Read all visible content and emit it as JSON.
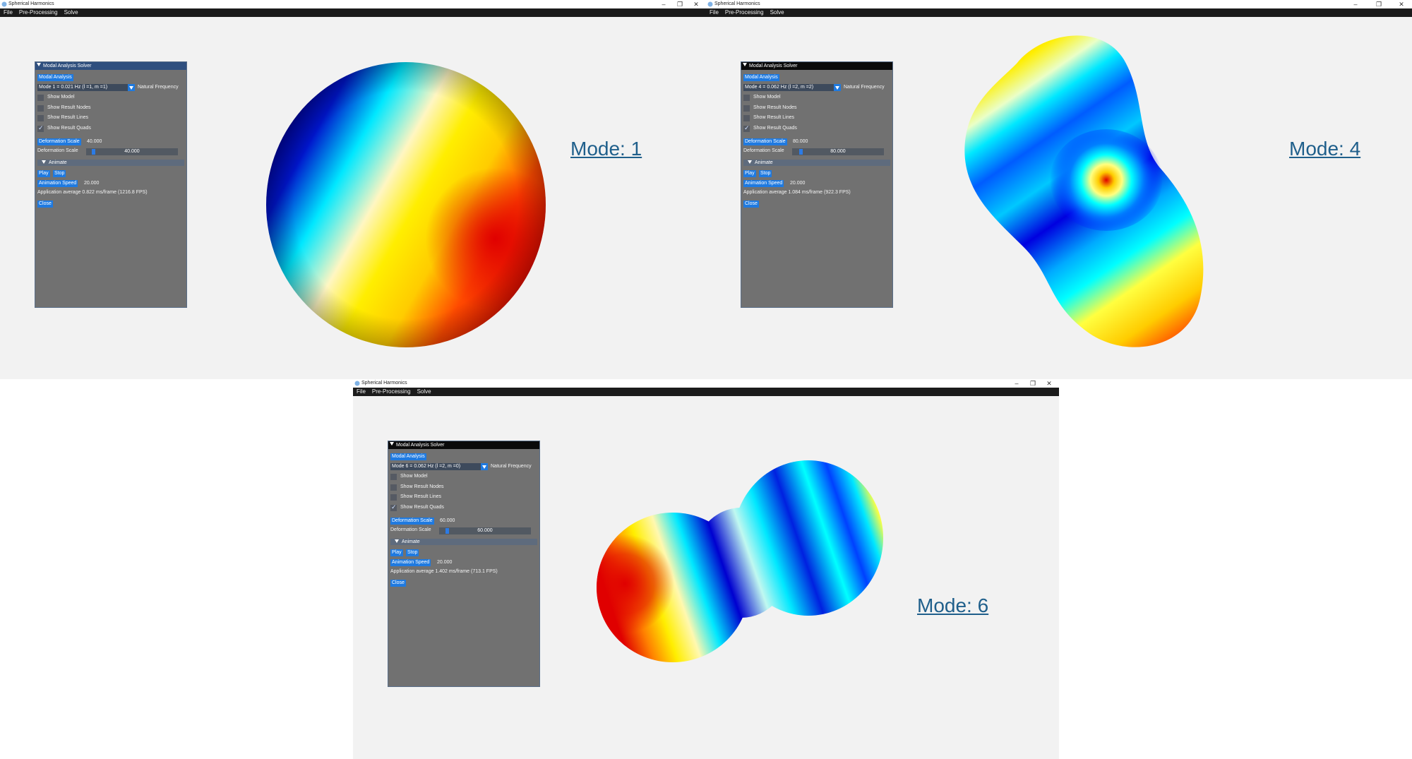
{
  "windows": [
    {
      "title": "Spherical Harmonics",
      "menu": [
        "File",
        "Pre-Processing",
        "Solve"
      ],
      "panel": {
        "title": "Modal Analysis Solver",
        "modal_btn": "Modal Analysis",
        "mode_select": "Mode 1 = 0.021 Hz (l =1, m =1)",
        "freq_label": "Natural Frequency",
        "checks": [
          "Show Model",
          "Show Result Nodes",
          "Show Result Lines",
          "Show Result Quads"
        ],
        "checked": [
          false,
          false,
          false,
          true
        ],
        "def_btn": "Deformation Scale",
        "def_val": "40.000",
        "def_label": "Deformation Scale",
        "def_slider": "40.000",
        "def_fraction": 0.06,
        "animate": "Animate",
        "play": "Play",
        "stop": "Stop",
        "speed_btn": "Animation Speed",
        "speed_val": "20.000",
        "app_avg": "Application average 0.822 ms/frame (1216.8 FPS)",
        "close": "Close"
      },
      "mode_label": "Mode: 1"
    },
    {
      "title": "Spherical Harmonics",
      "menu": [
        "File",
        "Pre-Processing",
        "Solve"
      ],
      "panel": {
        "title": "Modal Analysis Solver",
        "modal_btn": "Modal Analysis",
        "mode_select": "Mode 4 = 0.062 Hz (l =2, m =2)",
        "freq_label": "Natural Frequency",
        "checks": [
          "Show Model",
          "Show Result Nodes",
          "Show Result Lines",
          "Show Result Quads"
        ],
        "checked": [
          false,
          false,
          false,
          true
        ],
        "def_btn": "Deformation Scale",
        "def_val": "80.000",
        "def_label": "Deformation Scale",
        "def_slider": "80.000",
        "def_fraction": 0.08,
        "animate": "Animate",
        "play": "Play",
        "stop": "Stop",
        "speed_btn": "Animation Speed",
        "speed_val": "20.000",
        "app_avg": "Application average 1.084 ms/frame (922.3 FPS)",
        "close": "Close"
      },
      "mode_label": "Mode: 4"
    },
    {
      "title": "Spherical Harmonics",
      "menu": [
        "File",
        "Pre-Processing",
        "Solve"
      ],
      "panel": {
        "title": "Modal Analysis Solver",
        "modal_btn": "Modal Analysis",
        "mode_select": "Mode 6 = 0.062 Hz (l =2, m =0)",
        "freq_label": "Natural Frequency",
        "checks": [
          "Show Model",
          "Show Result Nodes",
          "Show Result Lines",
          "Show Result Quads"
        ],
        "checked": [
          false,
          false,
          false,
          true
        ],
        "def_btn": "Deformation Scale",
        "def_val": "60.000",
        "def_label": "Deformation Scale",
        "def_slider": "60.000",
        "def_fraction": 0.07,
        "animate": "Animate",
        "play": "Play",
        "stop": "Stop",
        "speed_btn": "Animation Speed",
        "speed_val": "20.000",
        "app_avg": "Application average 1.402 ms/frame (713.1 FPS)",
        "close": "Close"
      },
      "mode_label": "Mode: 6"
    }
  ],
  "colors": {
    "accent_blue": "#1f7ae0",
    "label_link": "#1f5f8b",
    "menubar": "#1b1b1b",
    "panel_bg": "#717171",
    "jet": [
      "#00008f",
      "#0000ff",
      "#00ffff",
      "#ffff00",
      "#ff0000"
    ]
  }
}
